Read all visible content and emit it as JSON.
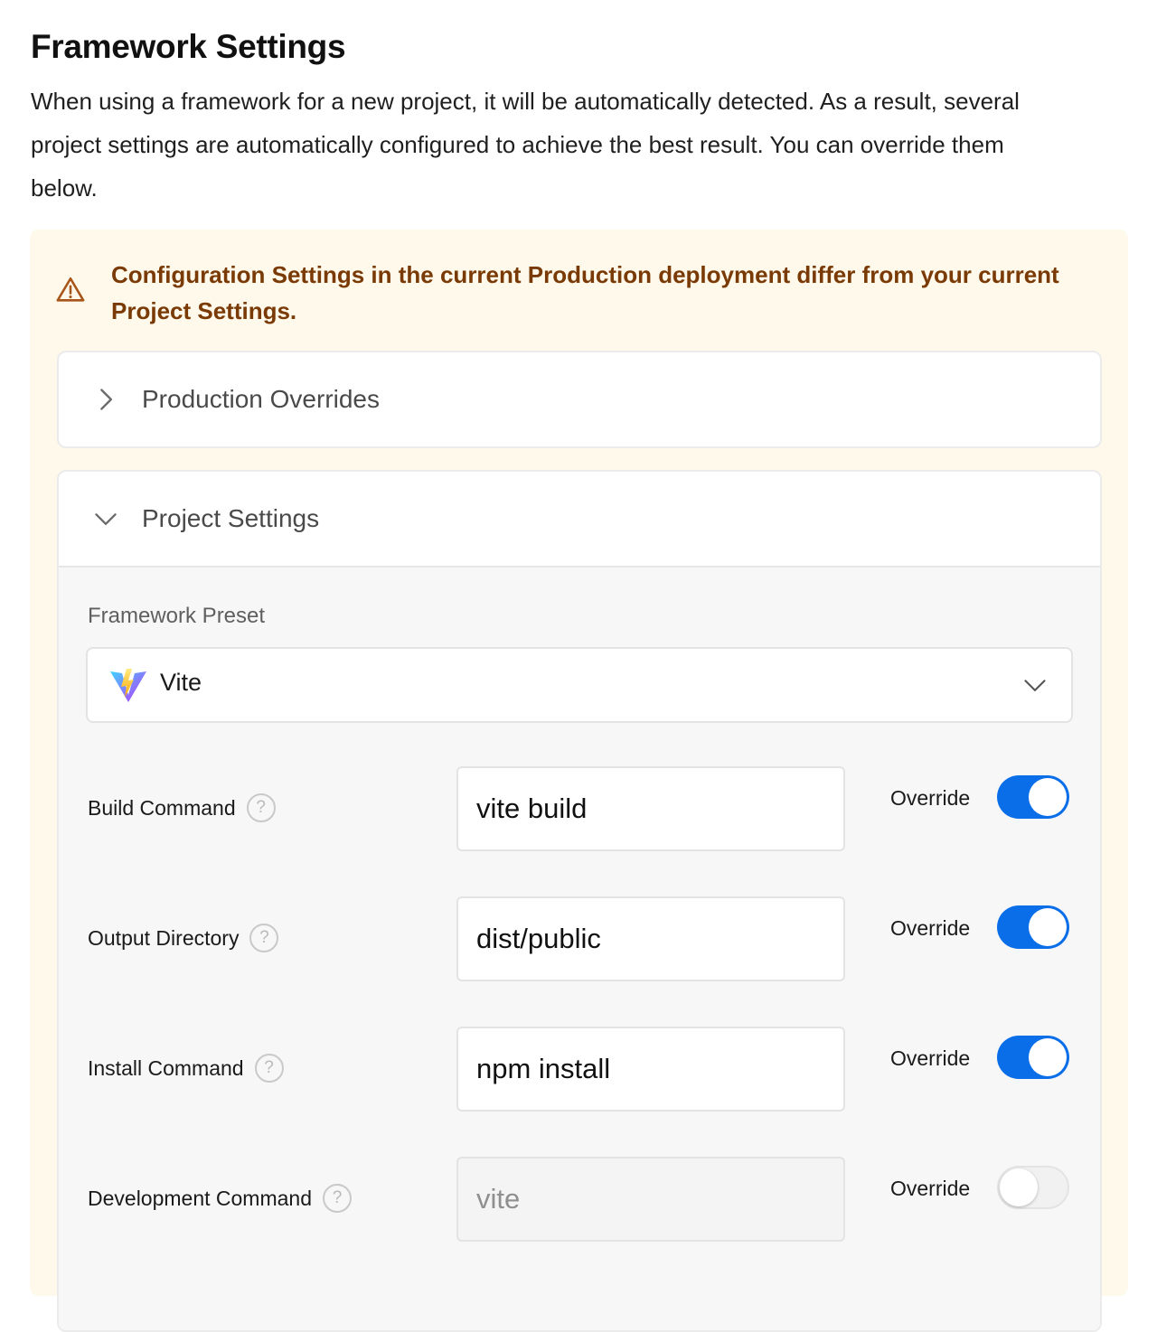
{
  "page": {
    "title": "Framework Settings",
    "description": "When using a framework for a new project, it will be automatically detected. As a result, several project settings are automatically configured to achieve the best result. You can override them below."
  },
  "warning": {
    "icon": "warning-triangle-icon",
    "text": "Configuration Settings in the current Production deployment differ from your current Project Settings.",
    "color": "#7a3a06",
    "background": "#fef9ea"
  },
  "production_overrides": {
    "label": "Production Overrides",
    "expanded": false
  },
  "project_settings": {
    "label": "Project Settings",
    "expanded": true,
    "framework_preset": {
      "label": "Framework Preset",
      "value": "Vite",
      "icon": "vite-logo"
    },
    "override_label": "Override",
    "rows": [
      {
        "label": "Build Command",
        "value": "vite build",
        "override": true
      },
      {
        "label": "Output Directory",
        "value": "dist/public",
        "override": true
      },
      {
        "label": "Install Command",
        "value": "npm install",
        "override": true
      },
      {
        "label": "Development Command",
        "value": "vite",
        "override": false
      }
    ]
  },
  "colors": {
    "toggle_on": "#0a6ee8",
    "toggle_off": "#f1f1f1"
  }
}
